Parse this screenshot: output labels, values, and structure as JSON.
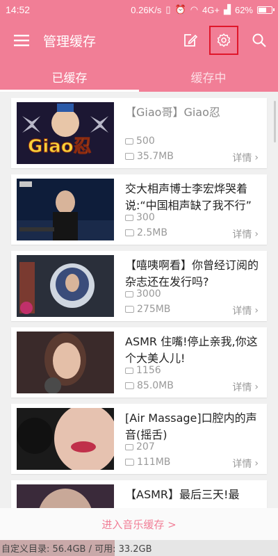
{
  "status": {
    "time": "14:52",
    "speed": "0.26K/s",
    "network": "4G+",
    "battery": "62%",
    "battery_level": 0.62
  },
  "appbar": {
    "title": "管理缓存"
  },
  "tabs": [
    {
      "label": "已缓存"
    },
    {
      "label": "缓存中"
    }
  ],
  "items": [
    {
      "title": "【Giao哥】Giao忍",
      "count": "500",
      "size": "35.7MB",
      "detail": "详情"
    },
    {
      "title": "交大相声博士李宏烨哭着说:“中国相声缺了我不行”",
      "count": "300",
      "size": "2.5MB",
      "detail": "详情"
    },
    {
      "title": "【嘻咦啊看】你曾经订阅的杂志还在发行吗?",
      "count": "3000",
      "size": "275MB",
      "detail": "详情"
    },
    {
      "title": "ASMR 住嘴!停止亲我,你这个大美人儿!",
      "count": "1156",
      "size": "85.0MB",
      "detail": "详情"
    },
    {
      "title": "[Air Massage]口腔内的声音(摇舌)",
      "count": "207",
      "size": "111MB",
      "detail": "详情"
    },
    {
      "title": "【ASMR】最后三天!最",
      "count": "",
      "size": "",
      "detail": ""
    }
  ],
  "music_link": "进入音乐缓存 >",
  "storage": {
    "text": "自定义目录: 56.4GB / 可用: 33.2GB"
  },
  "colors": {
    "accent": "#f17e96",
    "highlight": "#e0162a"
  }
}
